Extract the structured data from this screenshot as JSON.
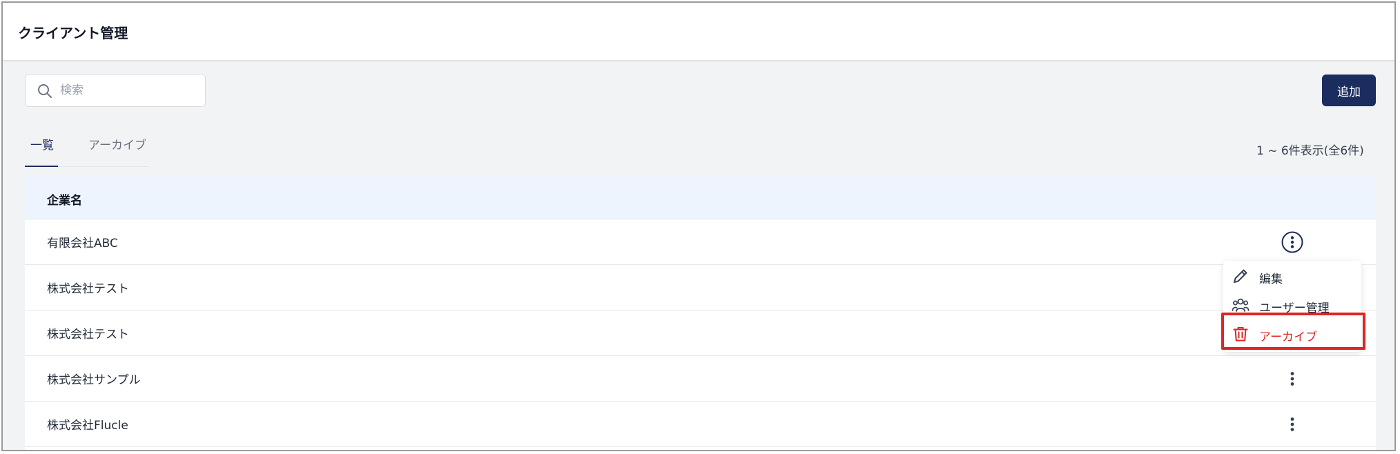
{
  "header": {
    "title": "クライアント管理"
  },
  "search": {
    "placeholder": "検索",
    "value": ""
  },
  "toolbar": {
    "add_label": "追加"
  },
  "tabs": [
    {
      "label": "一覧",
      "active": true
    },
    {
      "label": "アーカイブ",
      "active": false
    }
  ],
  "pagination": {
    "summary": "1 ~ 6件表示(全6件)"
  },
  "table": {
    "column_header": "企業名",
    "rows": [
      {
        "name": "有限会社ABC"
      },
      {
        "name": "株式会社テスト"
      },
      {
        "name": "株式会社テスト"
      },
      {
        "name": "株式会社サンプル"
      },
      {
        "name": "株式会社Flucle"
      }
    ]
  },
  "row_menu": {
    "items": [
      {
        "label": "編集",
        "icon": "pencil-icon"
      },
      {
        "label": "ユーザー管理",
        "icon": "users-icon"
      },
      {
        "label": "アーカイブ",
        "icon": "trash-icon"
      }
    ]
  },
  "colors": {
    "primary": "#1b2c5e",
    "danger": "#e02424",
    "table_header_bg": "#edf4fd",
    "page_bg": "#f2f3f5"
  }
}
